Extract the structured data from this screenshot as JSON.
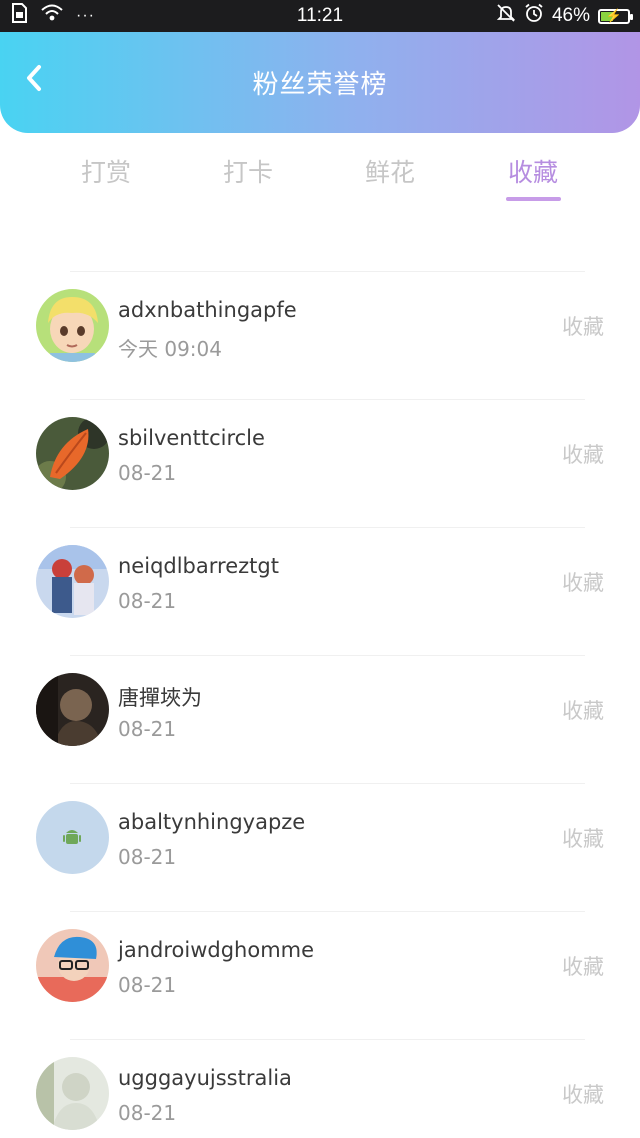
{
  "status_bar": {
    "time": "11:21",
    "dots": "···",
    "battery": "46%",
    "battery_level": 0.46
  },
  "header": {
    "title": "粉丝荣誉榜",
    "back_icon": "chevron-left-icon"
  },
  "tabs": [
    {
      "label": "打赏",
      "active": false
    },
    {
      "label": "打卡",
      "active": false
    },
    {
      "label": "鲜花",
      "active": false
    },
    {
      "label": "收藏",
      "active": true
    }
  ],
  "list": {
    "partial_name": "",
    "items": [
      {
        "name": "adxnbathingapfe",
        "time": "今天 09:04",
        "action": "收藏",
        "avatar": "cartoon-boy-avatar"
      },
      {
        "name": "sbilventtcircle",
        "time": "08-21",
        "action": "收藏",
        "avatar": "leaf-avatar"
      },
      {
        "name": "neiqdlbarreztgt",
        "time": "08-21",
        "action": "收藏",
        "avatar": "anime-couple-avatar"
      },
      {
        "name": "唐撣埉为",
        "time": "08-21",
        "action": "收藏",
        "avatar": "dark-photo-avatar"
      },
      {
        "name": "abaltynhingyapze",
        "time": "08-21",
        "action": "收藏",
        "avatar": "android-avatar"
      },
      {
        "name": "jandroiwdghomme",
        "time": "08-21",
        "action": "收藏",
        "avatar": "blue-cap-avatar"
      },
      {
        "name": "ugggayujsstralia",
        "time": "08-21",
        "action": "收藏",
        "avatar": "light-photo-avatar"
      }
    ]
  },
  "colors": {
    "header_gradient_start": "#49d3f2",
    "header_gradient_end": "#b195e6",
    "active_tab": "#b68de0",
    "inactive_tab": "#c6c6c6",
    "name_text": "#3a3a3a",
    "time_text": "#9a9a9a",
    "action_text": "#c9c9c9"
  }
}
